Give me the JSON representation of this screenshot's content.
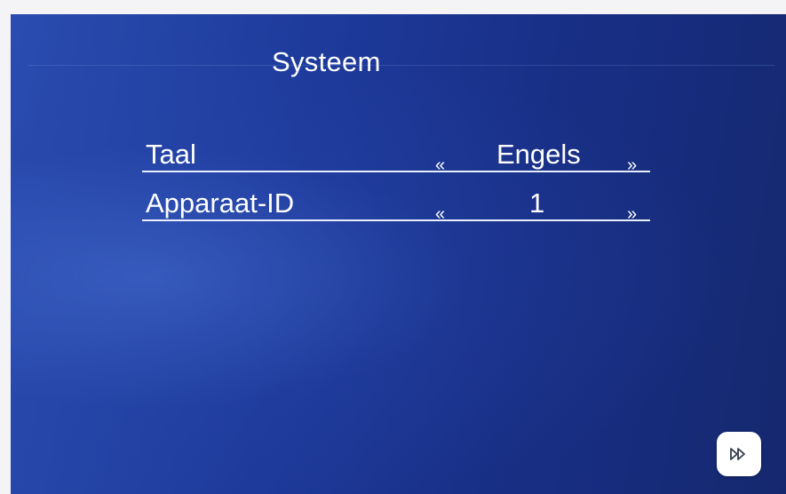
{
  "screen": {
    "title": "Systeem"
  },
  "settings": [
    {
      "label": "Taal",
      "prev_glyph": "«",
      "value": "Engels",
      "next_glyph": "»"
    },
    {
      "label": "Apparaat-ID",
      "prev_glyph": "«",
      "value": "1",
      "next_glyph": "»"
    }
  ],
  "footer": {
    "next_icon": "double-chevron-right-icon"
  },
  "colors": {
    "background_start": "#2a4cb0",
    "background_end": "#15286f",
    "text": "#ffffff"
  }
}
